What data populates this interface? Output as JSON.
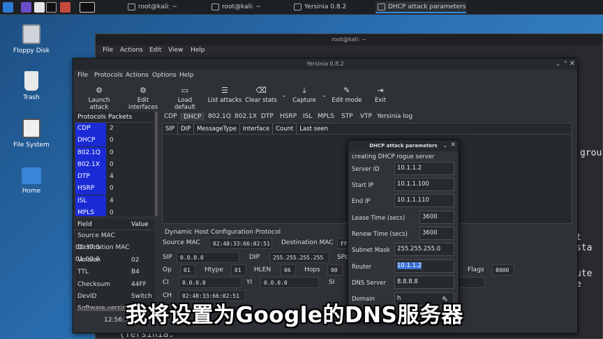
{
  "taskbar": {
    "tasks": [
      {
        "label": "root@kali: ~"
      },
      {
        "label": "root@kali: ~"
      },
      {
        "label": "Yersinia 0.8.2"
      },
      {
        "label": "DHCP attack parameters"
      }
    ]
  },
  "desktop": {
    "icons": [
      {
        "label": "Floppy Disk"
      },
      {
        "label": "Trash"
      },
      {
        "label": "File System"
      },
      {
        "label": "Home"
      }
    ]
  },
  "terminal": {
    "title": "root@kali: ~",
    "menu": [
      "File",
      "Actions",
      "Edit",
      "View",
      "Help"
    ],
    "text_fragments": [
      "grou",
      "t sta",
      "ute e",
      "(Yersinia:"
    ]
  },
  "yersinia": {
    "title": "Yersinia 0.8.2",
    "menu": [
      "File",
      "Protocols",
      "Actions",
      "Options",
      "Help"
    ],
    "toolbar": [
      {
        "label": "Launch attack",
        "icon": "launch-icon"
      },
      {
        "label": "Edit interfaces",
        "icon": "edit-interfaces-icon"
      },
      {
        "label": "Load default",
        "icon": "monitor-icon"
      },
      {
        "label": "List attacks",
        "icon": "list-icon"
      },
      {
        "label": "Clear stats",
        "icon": "clear-icon"
      },
      {
        "label": "Capture",
        "icon": "download-icon"
      },
      {
        "label": "Edit mode",
        "icon": "pencil-icon"
      },
      {
        "label": "Exit",
        "icon": "exit-icon"
      }
    ],
    "protocols_header": {
      "col1": "Protocols",
      "col2": "Packets"
    },
    "protocols": [
      {
        "name": "CDP",
        "count": "2"
      },
      {
        "name": "DHCP",
        "count": "0"
      },
      {
        "name": "802.1Q",
        "count": "0"
      },
      {
        "name": "802.1X",
        "count": "0"
      },
      {
        "name": "DTP",
        "count": "4"
      },
      {
        "name": "HSRP",
        "count": "0"
      },
      {
        "name": "ISL",
        "count": "4"
      },
      {
        "name": "MPLS",
        "count": "0"
      }
    ],
    "tabs": [
      "CDP",
      "DHCP",
      "802.1Q",
      "802.1X",
      "DTP",
      "HSRP",
      "ISL",
      "MPLS",
      "STP",
      "VTP",
      "Yersinia log"
    ],
    "selected_tab": "DHCP",
    "table_headers": [
      "SIP",
      "DIP",
      "MessageType",
      "Interface",
      "Count",
      "Last seen"
    ],
    "field_header": {
      "col1": "Field",
      "col2": "Value"
    },
    "fields": [
      {
        "name": "Source MAC",
        "value": "0C:37:5"
      },
      {
        "name": "Destination MAC",
        "value": "01:00:0"
      },
      {
        "name": "Version",
        "value": "02"
      },
      {
        "name": "TTL",
        "value": "B4"
      },
      {
        "name": "Checksum",
        "value": "44FF"
      },
      {
        "name": "DevID",
        "value": "Switch"
      },
      {
        "name": "Software version",
        "value": ""
      }
    ],
    "detail": {
      "section_title": "Dynamic Host Configuration Protocol",
      "source_mac_label": "Source MAC",
      "source_mac": "02:48:33:66:02:51",
      "dest_mac_label": "Destination MAC",
      "dest_mac_partial": "FF",
      "sip_label": "SIP",
      "sip": "0.0.0.0",
      "dip_label": "DIP",
      "dip": "255.255.255.255",
      "sport_label": "SPo",
      "op_label": "Op",
      "op": "01",
      "htype_label": "Htype",
      "htype": "01",
      "hlen_label": "HLEN",
      "hlen": "06",
      "hops_label": "Hops",
      "hops": "00",
      "flags_label": "Flags",
      "flags": "8000",
      "ci_label": "CI",
      "ci": "0.0.0.0",
      "yi_label": "YI",
      "yi": "0.0.0.0",
      "si_label": "SI",
      "ch_label": "CH",
      "ch": "02:48:33:66:02:51"
    },
    "status_time": "12:56:3"
  },
  "dialog": {
    "title": "DHCP attack parameters",
    "subtitle": "creating DHCP rogue server",
    "fields": [
      {
        "label": "Server ID",
        "value": "10.1.1.2"
      },
      {
        "label": "Start IP",
        "value": "10.1.1.100"
      },
      {
        "label": "End IP",
        "value": "10.1.1.110"
      },
      {
        "label": "Lease Time (secs)",
        "value": "3600"
      },
      {
        "label": "Renew Time (secs)",
        "value": "3600"
      },
      {
        "label": "Subnet Mask",
        "value": "255.255.255.0"
      },
      {
        "label": "Router",
        "value": "10.1.1.2"
      },
      {
        "label": "DNS Server",
        "value": "8.8.8.8"
      },
      {
        "label": "Domain",
        "value": "h"
      }
    ]
  },
  "subtitle": "我将设置为Google的DNS服务器",
  "colors": {
    "accent": "#1a2bd6",
    "selection": "#3c6fd0"
  }
}
